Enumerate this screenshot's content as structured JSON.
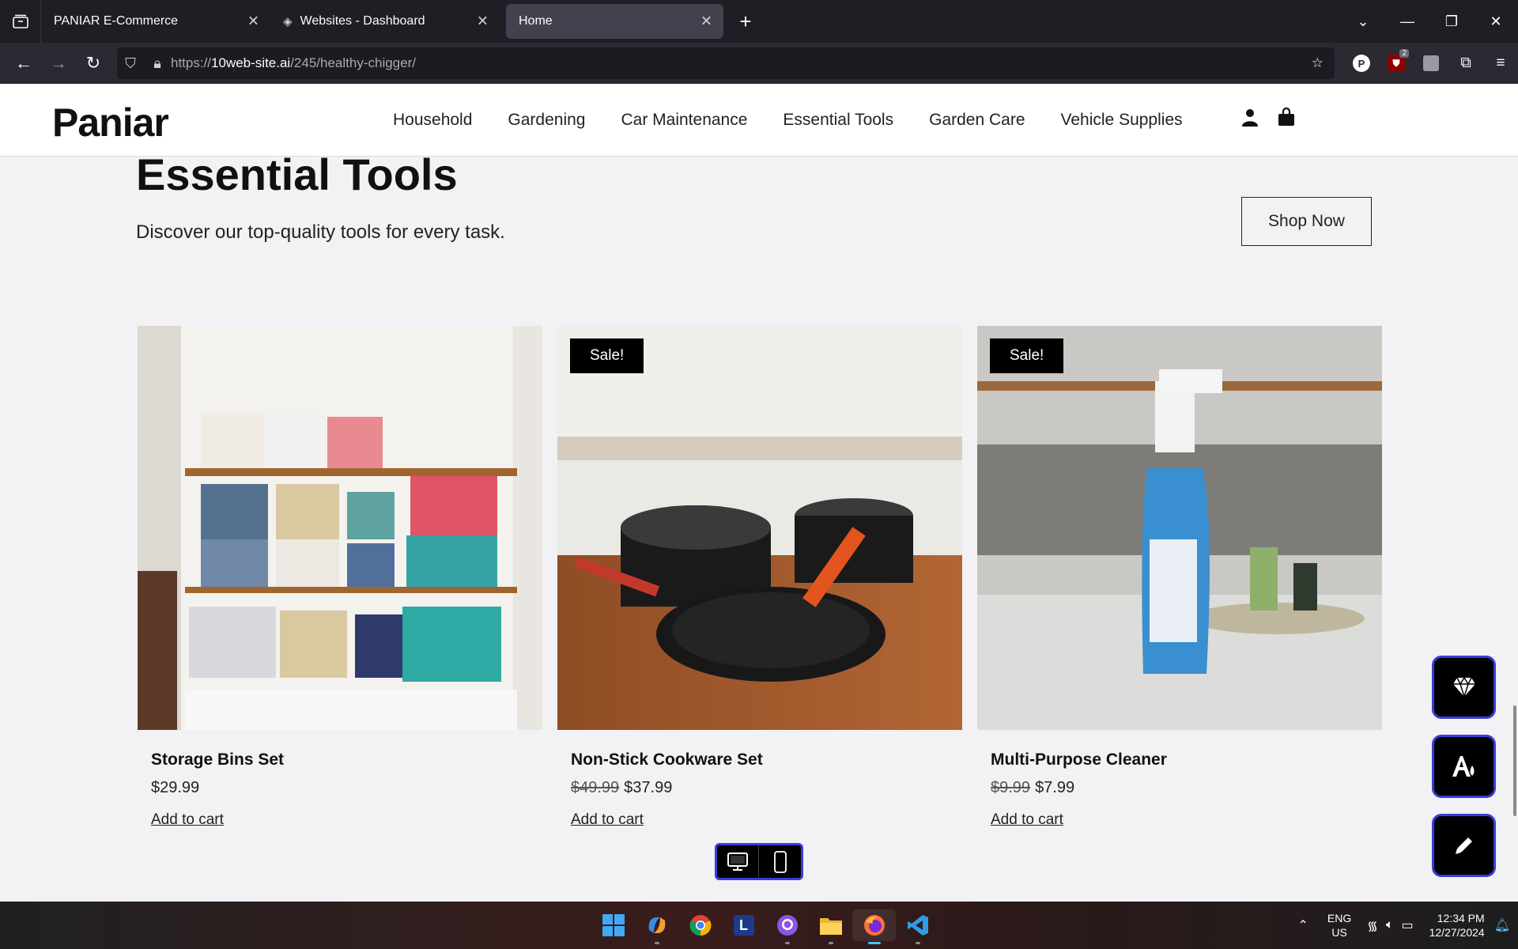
{
  "browser": {
    "tabs": [
      {
        "title": "PANIAR E-Commerce",
        "active": false
      },
      {
        "title": "Websites - Dashboard",
        "active": false
      },
      {
        "title": "Home",
        "active": true
      }
    ],
    "url_prefix": "https://",
    "url_host": "10web-site.ai",
    "url_path": "/245/healthy-chigger/",
    "extension_badge": "2",
    "profile_letter": "P"
  },
  "site": {
    "logo": "Paniar",
    "nav": [
      "Household",
      "Gardening",
      "Car Maintenance",
      "Essential Tools",
      "Garden Care",
      "Vehicle Supplies"
    ]
  },
  "section": {
    "title": "Essential Tools",
    "subtitle": "Discover our top-quality tools for every task.",
    "cta": "Shop Now"
  },
  "products": [
    {
      "name": "Storage Bins Set",
      "price": "$29.99",
      "old_price": "",
      "sale": "",
      "cart": "Add to cart"
    },
    {
      "name": "Non-Stick Cookware Set",
      "price": "$37.99",
      "old_price": "$49.99",
      "sale": "Sale!",
      "cart": "Add to cart"
    },
    {
      "name": "Multi-Purpose Cleaner",
      "price": "$7.99",
      "old_price": "$9.99",
      "sale": "Sale!",
      "cart": "Add to cart"
    }
  ],
  "taskbar": {
    "lang_line1": "ENG",
    "lang_line2": "US",
    "time": "12:34 PM",
    "date": "12/27/2024"
  }
}
